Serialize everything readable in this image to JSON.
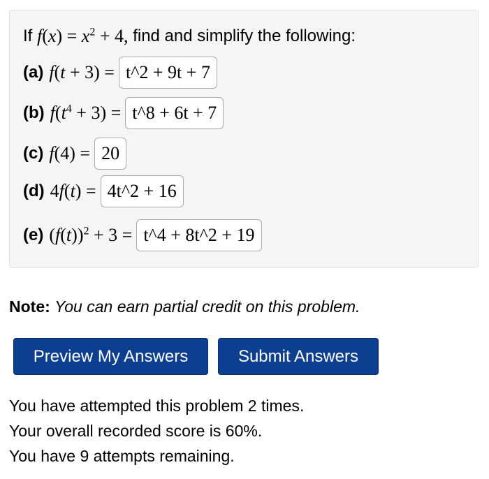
{
  "problem": {
    "intro": "find and simplify the following:",
    "parts": [
      {
        "label": "(a)",
        "answer": "t^2 + 9t + 7"
      },
      {
        "label": "(b)",
        "answer": "t^8 + 6t + 7"
      },
      {
        "label": "(c)",
        "answer": "20"
      },
      {
        "label": "(d)",
        "answer": "4t^2 + 16"
      },
      {
        "label": "(e)",
        "answer": "t^4 + 8t^2 + 19"
      }
    ]
  },
  "note": {
    "label": "Note:",
    "text": "You can earn partial credit on this problem."
  },
  "buttons": {
    "preview": "Preview My Answers",
    "submit": "Submit Answers"
  },
  "status": {
    "attempts": "You have attempted this problem 2 times.",
    "score": "Your overall recorded score is 60%.",
    "remaining": "You have 9 attempts remaining."
  },
  "colors": {
    "button_bg": "#0d3f91",
    "panel_bg": "#f5f5f5"
  }
}
